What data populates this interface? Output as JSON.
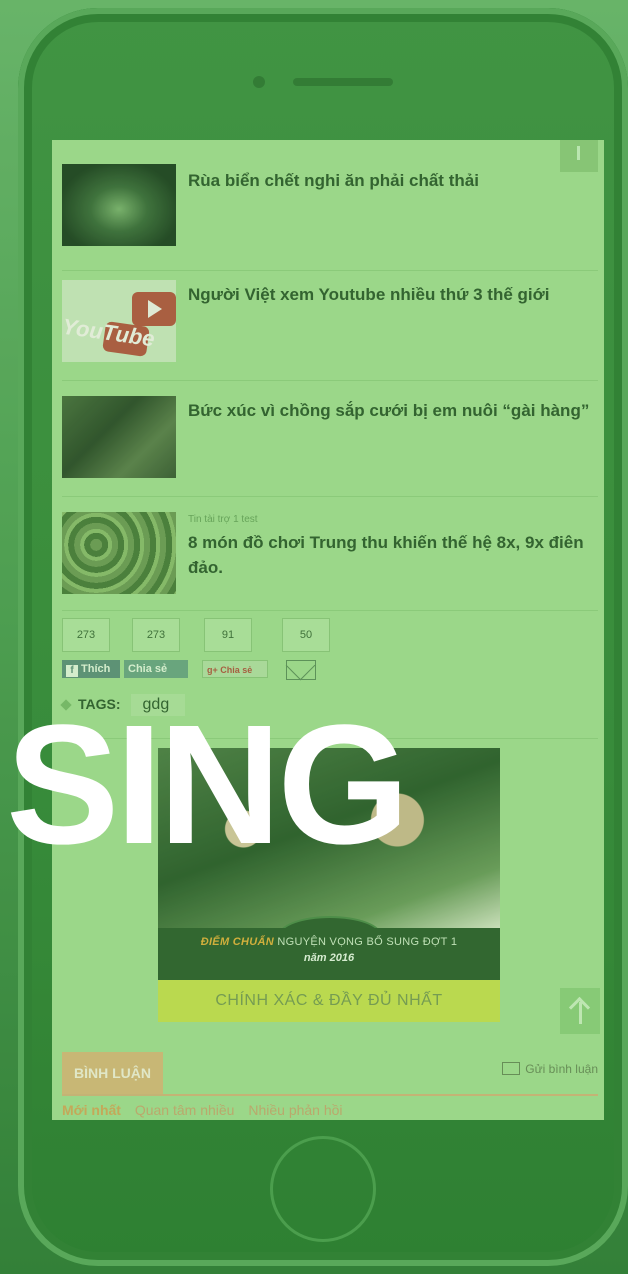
{
  "articles": [
    {
      "title": "Rùa biển chết nghi ăn phải chất thải",
      "sponsor": ""
    },
    {
      "title": "Người Việt xem Youtube nhiều thứ 3 thế giới",
      "sponsor": ""
    },
    {
      "title": "Bức xúc vì chồng sắp cưới bị em nuôi “gài hàng”",
      "sponsor": ""
    },
    {
      "title": "8 món đồ chơi Trung thu khiến thế hệ 8x, 9x điên đảo.",
      "sponsor": "Tin tài trợ 1 test"
    }
  ],
  "youtube_thumb_text": "YouTube",
  "shares": {
    "counts": [
      "273",
      "273",
      "91",
      "50"
    ],
    "facebook_like": "Thích",
    "facebook_share": "Chia sẻ",
    "gplus_share": "Chia sẻ",
    "gplus_icon": "g+"
  },
  "tags": {
    "label": "TAGS:",
    "items": [
      "gdg"
    ]
  },
  "banner": {
    "line1_highlight": "ĐIỂM CHUẨN",
    "line1_rest": "NGUYỆN VỌNG BỔ SUNG ĐỢT 1",
    "line2": "năm 2016",
    "bottom": "CHÍNH XÁC & ĐẦY ĐỦ NHẤT"
  },
  "comments": {
    "title": "BÌNH LUẬN",
    "send_label": "Gửi bình luận",
    "tabs": [
      "Mới nhất",
      "Quan tâm nhiều",
      "Nhiều phản hồi"
    ]
  },
  "overlay_text": "SING",
  "colors": {
    "overlay_green": "#4fae52",
    "accent": "#d9b97a"
  }
}
